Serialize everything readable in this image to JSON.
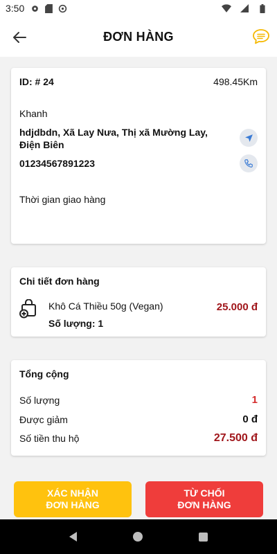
{
  "status_bar": {
    "time": "3:50",
    "icons": [
      "gear-icon",
      "sd-card-icon",
      "at-sign-icon",
      "wifi-icon",
      "cellular-icon",
      "battery-icon"
    ]
  },
  "header": {
    "title": "ĐƠN HÀNG",
    "back_icon": "arrow-left-icon",
    "chat_icon": "chat-bubble-icon",
    "accent_color": "#ffc20e"
  },
  "order": {
    "id_label": "ID: # 24",
    "distance": "498.45Km",
    "customer_name": "Khanh",
    "address": "hdjdbdn, Xã Lay Nưa, Thị xã Mường Lay, Điện Biên",
    "phone": "01234567891223",
    "delivery_time_label": "Thời gian giao hàng"
  },
  "details": {
    "title": "Chi tiết đơn hàng",
    "items": [
      {
        "name": "Khô Cá Thiều 50g (Vegan)",
        "quantity_label": "Số lượng: 1",
        "price": "25.000 đ"
      }
    ]
  },
  "summary": {
    "title": "Tổng cộng",
    "quantity_label": "Số lượng",
    "quantity_value": "1",
    "discount_label": "Được giảm",
    "discount_value": "0 đ",
    "cod_label": "Số tiền thu hộ",
    "cod_value": "27.500 đ"
  },
  "actions": {
    "confirm_line1": "XÁC NHẬN",
    "confirm_line2": "ĐƠN HÀNG",
    "confirm_color": "#ffc20e",
    "reject_line1": "TỪ CHỐI",
    "reject_line2": "ĐƠN HÀNG",
    "reject_color": "#ef3d3b"
  }
}
